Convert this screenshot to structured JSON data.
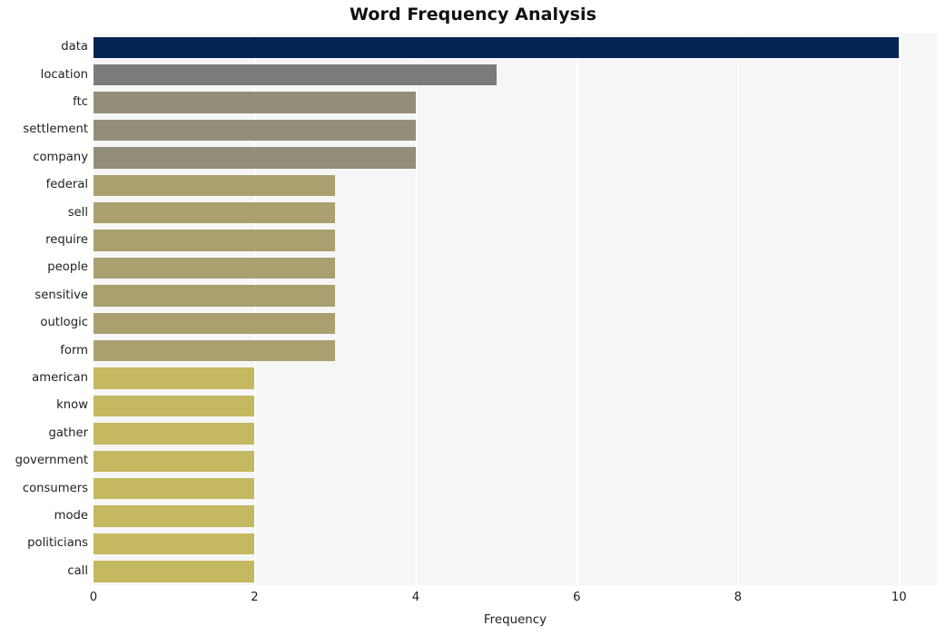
{
  "chart_data": {
    "type": "bar",
    "orientation": "horizontal",
    "title": "Word Frequency Analysis",
    "xlabel": "Frequency",
    "ylabel": "",
    "categories": [
      "data",
      "location",
      "ftc",
      "settlement",
      "company",
      "federal",
      "sell",
      "require",
      "people",
      "sensitive",
      "outlogic",
      "form",
      "american",
      "know",
      "gather",
      "government",
      "consumers",
      "mode",
      "politicians",
      "call"
    ],
    "values": [
      10,
      5,
      4,
      4,
      4,
      3,
      3,
      3,
      3,
      3,
      3,
      3,
      2,
      2,
      2,
      2,
      2,
      2,
      2,
      2
    ],
    "bar_colors": [
      "#032553",
      "#7d7b79",
      "#938e79",
      "#938e79",
      "#938e79",
      "#aa9f6e",
      "#aa9f6e",
      "#aa9f6e",
      "#aa9f6e",
      "#aa9f6e",
      "#aa9f6e",
      "#aa9f6e",
      "#c4b860",
      "#c4b860",
      "#c4b860",
      "#c4b860",
      "#c4b860",
      "#c4b860",
      "#c4b860",
      "#c4b860"
    ],
    "xlim": [
      0,
      10.47
    ],
    "xticks": [
      0,
      2,
      4,
      6,
      8,
      10
    ],
    "xtick_labels": [
      "0",
      "2",
      "4",
      "6",
      "8",
      "10"
    ],
    "grid": true,
    "grid_axis": "x",
    "grid_color": "#ffffff",
    "legend": null,
    "plot_background": "#f6f6f7",
    "figure_background": "#ffffff"
  },
  "style": {
    "title_color": "#111111",
    "tick_color": "#222222"
  }
}
